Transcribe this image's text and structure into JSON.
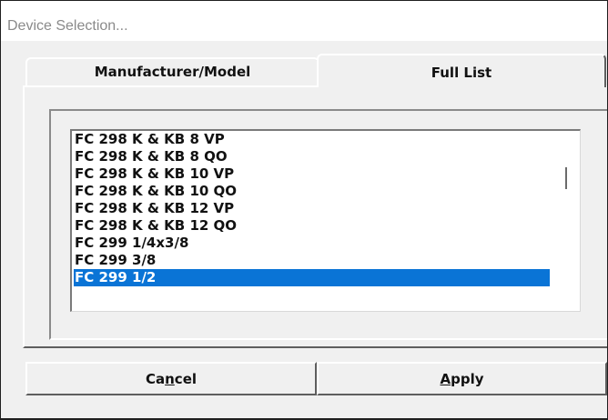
{
  "window": {
    "title": "Device Selection..."
  },
  "tabs": [
    {
      "label": "Manufacturer/Model",
      "active": false
    },
    {
      "label": "Full List",
      "active": true
    }
  ],
  "device_list": {
    "items": [
      "FC 298 K & KB 8 VP",
      "FC 298 K & KB 8 QO",
      "FC 298 K & KB 10 VP",
      "FC 298 K & KB 10 QO",
      "FC 298 K & KB 12 VP",
      "FC 298 K & KB 12 QO",
      "FC 299 1/4x3/8",
      "FC 299 3/8",
      "FC 299 1/2"
    ],
    "selected": "FC 299 1/2"
  },
  "buttons": {
    "cancel": {
      "before": "Ca",
      "mnemonic": "n",
      "after": "cel"
    },
    "apply": {
      "before": "",
      "mnemonic": "A",
      "after": "pply"
    }
  },
  "colors": {
    "selection": "#0a74d6",
    "window_bg": "#f0f0f0"
  }
}
